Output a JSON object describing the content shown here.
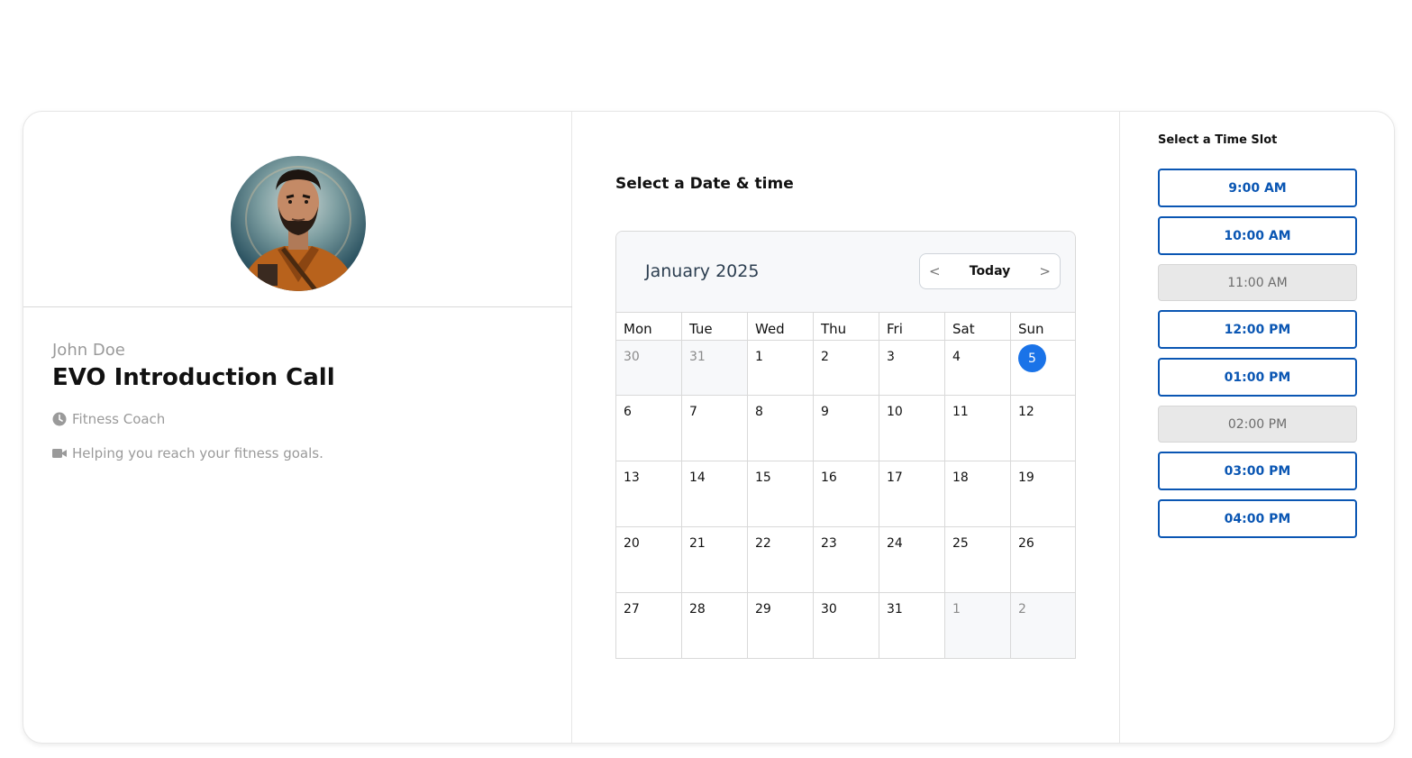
{
  "host": {
    "name": "John Doe",
    "event_title": "EVO Introduction Call",
    "role": "Fitness Coach",
    "description": "Helping you reach your fitness goals."
  },
  "calendar": {
    "heading": "Select a Date & time",
    "month_label": "January 2025",
    "nav": {
      "prev": "<",
      "today": "Today",
      "next": ">"
    },
    "weekdays": [
      "Mon",
      "Tue",
      "Wed",
      "Thu",
      "Fri",
      "Sat",
      "Sun"
    ],
    "weeks": [
      [
        "30",
        "31",
        "1",
        "2",
        "3",
        "4",
        "5"
      ],
      [
        "6",
        "7",
        "8",
        "9",
        "10",
        "11",
        "12"
      ],
      [
        "13",
        "14",
        "15",
        "16",
        "17",
        "18",
        "19"
      ],
      [
        "20",
        "21",
        "22",
        "23",
        "24",
        "25",
        "26"
      ],
      [
        "27",
        "28",
        "29",
        "30",
        "31",
        "1",
        "2"
      ]
    ],
    "selected_day": "5",
    "accent_color": "#1a73e8"
  },
  "time_slots": {
    "title": "Select a Time Slot",
    "slots": [
      {
        "label": "9:00 AM",
        "available": true
      },
      {
        "label": "10:00 AM",
        "available": true
      },
      {
        "label": "11:00 AM",
        "available": false
      },
      {
        "label": "12:00 PM",
        "available": true
      },
      {
        "label": "01:00 PM",
        "available": true
      },
      {
        "label": "02:00 PM",
        "available": false
      },
      {
        "label": "03:00 PM",
        "available": true
      },
      {
        "label": "04:00 PM",
        "available": true
      }
    ],
    "slot_color": "#0a56b3"
  }
}
